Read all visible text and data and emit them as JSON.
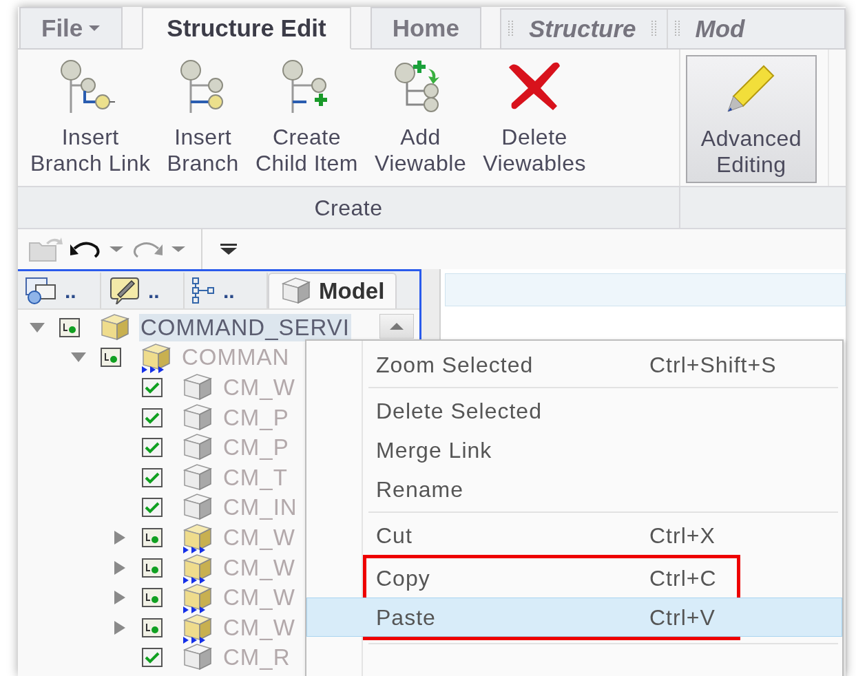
{
  "menu_bar": {
    "tabs": [
      {
        "label": "File",
        "kind": "menu",
        "selected": false
      },
      {
        "label": "Structure Edit",
        "kind": "tab",
        "selected": true
      },
      {
        "label": "Home",
        "kind": "tab",
        "selected": false
      }
    ],
    "toolbars": [
      {
        "label": "Structure"
      },
      {
        "label": "Mod"
      }
    ]
  },
  "ribbon": {
    "groups": [
      {
        "label": "Create",
        "buttons": [
          {
            "kind": "insert-branch-link",
            "lines": [
              "Insert",
              "Branch Link"
            ],
            "pressed": false
          },
          {
            "kind": "insert-branch",
            "lines": [
              "Insert",
              "Branch"
            ],
            "pressed": false
          },
          {
            "kind": "create-child-item",
            "lines": [
              "Create",
              "Child Item"
            ],
            "pressed": false
          },
          {
            "kind": "add-viewable",
            "lines": [
              "Add",
              "Viewable"
            ],
            "pressed": false
          },
          {
            "kind": "delete-viewables",
            "lines": [
              "Delete",
              "Viewables"
            ],
            "pressed": false
          }
        ]
      },
      {
        "buttons": [
          {
            "kind": "advanced-editing",
            "lines": [
              "Advanced",
              "Editing"
            ],
            "pressed": true
          }
        ]
      }
    ]
  },
  "quick_access": [
    {
      "kind": "open-folder",
      "disabled": true
    },
    {
      "kind": "undo",
      "disabled": false
    },
    {
      "kind": "dropdown"
    },
    {
      "kind": "redo",
      "disabled": true
    },
    {
      "kind": "dropdown"
    },
    {
      "kind": "separator"
    },
    {
      "kind": "overflow"
    }
  ],
  "panel_tabs": [
    {
      "kind": "properties",
      "label": "..",
      "selected": false
    },
    {
      "kind": "notes",
      "label": "..",
      "selected": false
    },
    {
      "kind": "tree",
      "label": "..",
      "selected": false
    },
    {
      "kind": "model",
      "label": "Model",
      "selected": true
    }
  ],
  "tree": [
    {
      "label": "COMMAND_SERVI",
      "kind": "assembly",
      "expanded": true,
      "selected": true,
      "children": [
        {
          "label": "COMMAN",
          "kind": "linked-assembly",
          "expanded": true,
          "selected": false,
          "children": [
            {
              "label": "CM_W",
              "kind": "part",
              "checked": true,
              "selected": false
            },
            {
              "label": "CM_P",
              "kind": "part",
              "checked": true,
              "selected": false
            },
            {
              "label": "CM_P",
              "kind": "part",
              "checked": true,
              "selected": false
            },
            {
              "label": "CM_T",
              "kind": "part",
              "checked": true,
              "selected": false
            },
            {
              "label": "CM_IN",
              "kind": "part",
              "checked": true,
              "selected": false
            },
            {
              "label": "CM_W",
              "kind": "linked-assembly",
              "expanded": false,
              "selected": false
            },
            {
              "label": "CM_W",
              "kind": "linked-assembly",
              "expanded": false,
              "selected": false
            },
            {
              "label": "CM_W",
              "kind": "linked-assembly",
              "expanded": false,
              "selected": false
            },
            {
              "label": "CM_W",
              "kind": "linked-assembly",
              "expanded": false,
              "selected": false
            },
            {
              "label": "CM_R",
              "kind": "part",
              "checked": true,
              "selected": false
            }
          ]
        }
      ]
    }
  ],
  "context_menu": {
    "groups": [
      [
        {
          "label": "Zoom Selected",
          "shortcut": "Ctrl+Shift+S",
          "selected": false,
          "marked": false
        }
      ],
      [
        {
          "label": "Delete Selected",
          "selected": false,
          "marked": false
        },
        {
          "label": "Merge Link",
          "selected": false,
          "marked": false
        },
        {
          "label": "Rename",
          "selected": false,
          "marked": false
        }
      ],
      [
        {
          "label": "Cut",
          "shortcut": "Ctrl+X",
          "selected": false,
          "marked": false
        },
        {
          "label": "Copy",
          "shortcut": "Ctrl+C",
          "selected": false,
          "marked": true
        },
        {
          "label": "Paste",
          "shortcut": "Ctrl+V",
          "selected": true,
          "marked": true
        }
      ]
    ]
  }
}
